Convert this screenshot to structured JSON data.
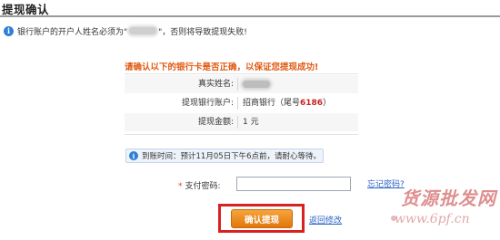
{
  "page": {
    "title": "提现确认"
  },
  "notice": {
    "text_before": "银行账户的开户人姓名必须为\"",
    "text_after": "\"，否则将导致提现失败!"
  },
  "confirm": {
    "heading": "请确认以下的银行卡是否正确，以保证您提现成功!",
    "rows": [
      {
        "label": "真实姓名:"
      },
      {
        "label": "提现银行账户:",
        "bank": "招商银行（尾号",
        "tail": "6186",
        "close": "）"
      },
      {
        "label": "提现金额:",
        "value": "1 元"
      }
    ]
  },
  "arrival": {
    "text": "到账时间：预计11月05日下午6点前，请耐心等待。"
  },
  "payment": {
    "required_mark": "*",
    "label": "支付密码:",
    "value": "",
    "forgot_link": "忘记密码?"
  },
  "actions": {
    "confirm_button": "确认提现",
    "back_link": "返回修改",
    "highlight_color": "#d82222"
  },
  "watermark": {
    "main": "货源批发网",
    "url": "www.6pf.cn"
  }
}
